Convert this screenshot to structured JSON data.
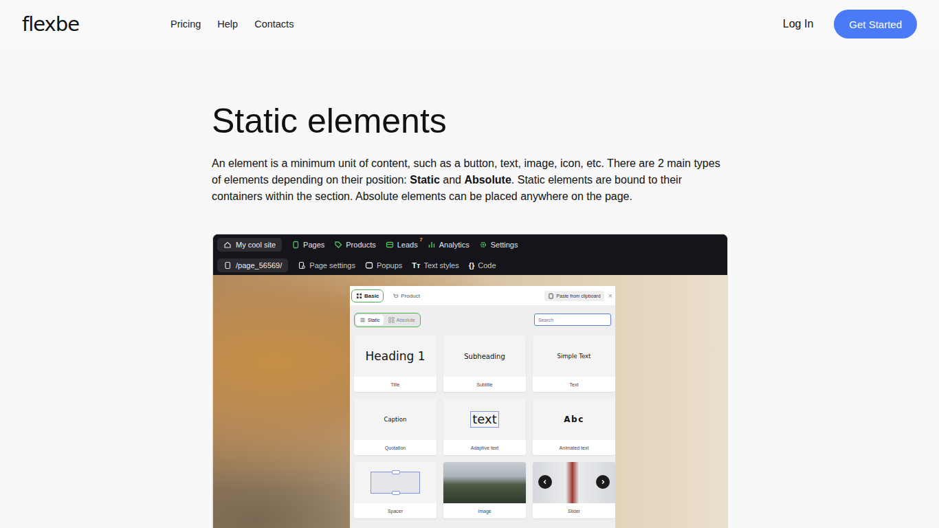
{
  "header": {
    "logo": "flexbe",
    "nav": [
      "Pricing",
      "Help",
      "Contacts"
    ],
    "login": "Log In",
    "cta": "Get Started"
  },
  "article": {
    "title": "Static elements",
    "intro": [
      {
        "text": "An element is a minimum unit of content, such as a button, text, image, icon, etc. There are 2 main types of elements depending on their position: ",
        "bold": false
      },
      {
        "text": "Static",
        "bold": true
      },
      {
        "text": " and ",
        "bold": false
      },
      {
        "text": "Absolute",
        "bold": true
      },
      {
        "text": ". Static elements are bound to their containers within the section. Absolute elements can be placed anywhere on the page.",
        "bold": false
      }
    ]
  },
  "editor": {
    "site": "My cool site",
    "menu": [
      {
        "label": "Pages"
      },
      {
        "label": "Products"
      },
      {
        "label": "Leads",
        "badge": "7"
      },
      {
        "label": "Analytics"
      },
      {
        "label": "Settings"
      }
    ],
    "page": "/page_56569/",
    "toolbar": [
      {
        "label": "Page settings"
      },
      {
        "label": "Popups"
      },
      {
        "label": "Text styles",
        "icon": "Tт"
      },
      {
        "label": "Code",
        "icon": "{}"
      }
    ],
    "panel": {
      "tabs": [
        {
          "label": "Basic",
          "selected": true
        },
        {
          "label": "Product",
          "selected": false
        }
      ],
      "paste": "Paste from clipboard",
      "close": "×",
      "modes": [
        {
          "label": "Static",
          "selected": true
        },
        {
          "label": "Absolute",
          "selected": false
        }
      ],
      "search": {
        "placeholder": "Search"
      },
      "cards": [
        {
          "kind": "heading",
          "preview": "Heading 1",
          "label": "Title"
        },
        {
          "kind": "subheading",
          "preview": "Subheading",
          "label": "Subtitle"
        },
        {
          "kind": "simple",
          "preview": "Simple Text",
          "label": "Text"
        },
        {
          "kind": "caption",
          "preview": "Caption",
          "label": "Quotation"
        },
        {
          "kind": "adaptive",
          "preview": "text",
          "label": "Adaptive text"
        },
        {
          "kind": "animated",
          "preview": "Abc",
          "label": "Animated text"
        },
        {
          "kind": "spacer",
          "label": "Spacer"
        },
        {
          "kind": "image",
          "label": "Image"
        },
        {
          "kind": "slider",
          "label": "Slider"
        }
      ]
    }
  }
}
